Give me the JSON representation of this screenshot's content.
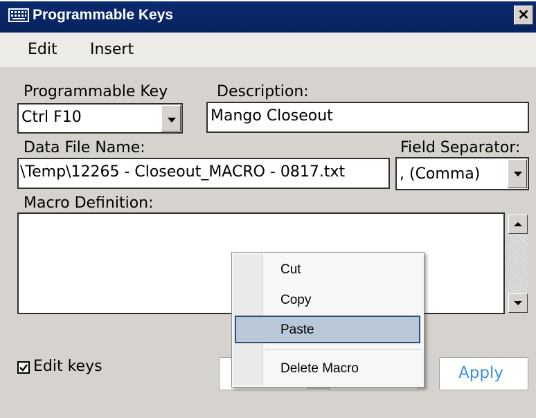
{
  "window": {
    "title": "Programmable Keys",
    "close_glyph": "✕",
    "icon": "keyboard-icon"
  },
  "menu": {
    "edit": "Edit",
    "insert": "Insert"
  },
  "form": {
    "programmable_key_label": "Programmable Key",
    "programmable_key_value": "Ctrl F10",
    "description_label": "Description:",
    "description_value": "Mango Closeout",
    "data_file_label": "Data File Name:",
    "data_file_value": "\\Temp\\12265 - Closeout_MACRO - 0817.txt",
    "field_separator_label": "Field Separator:",
    "field_separator_value": ", (Comma)",
    "macro_definition_label": "Macro Definition:",
    "macro_definition_value": ""
  },
  "footer": {
    "edit_keys_label": "Edit keys",
    "edit_keys_checked": true,
    "apply_label": "Apply",
    "apply_color": "#3d8fe0"
  },
  "context_menu": {
    "items": [
      "Cut",
      "Copy",
      "Paste",
      "Delete Macro"
    ],
    "highlighted": "Paste"
  },
  "colors": {
    "titlebar": "#0b2a6e",
    "window_bg": "#d6d3ce",
    "highlight": "#b9c8d9"
  }
}
